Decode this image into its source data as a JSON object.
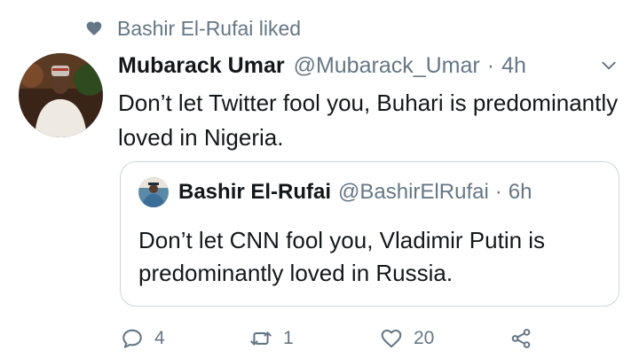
{
  "social_context": {
    "icon": "heart-icon",
    "text": "Bashir El-Rufai liked"
  },
  "tweet": {
    "display_name": "Mubarack Umar",
    "handle": "@Mubarack_Umar",
    "separator": "·",
    "time": "4h",
    "text": "Don’t let Twitter fool you, Buhari is predominantly loved in Nigeria."
  },
  "quoted_tweet": {
    "display_name": "Bashir El-Rufai",
    "handle": "@BashirElRufai",
    "separator": "·",
    "time": "6h",
    "text": "Don’t let CNN fool you, Vladimir Putin is predominantly loved in Russia."
  },
  "actions": {
    "reply_count": "4",
    "retweet_count": "1",
    "like_count": "20"
  },
  "colors": {
    "text": "#14171a",
    "secondary": "#657786",
    "border": "#ccd6dd"
  }
}
